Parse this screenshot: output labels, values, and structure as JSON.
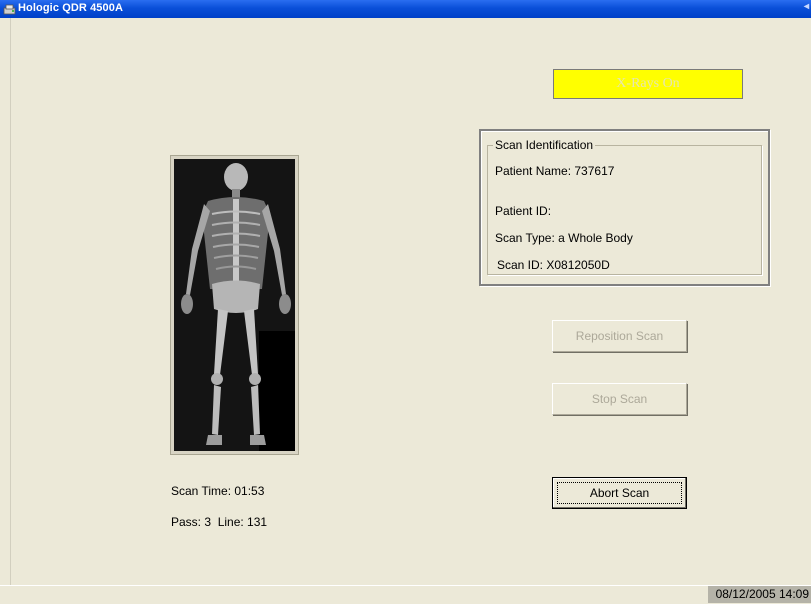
{
  "window": {
    "title": "Hologic QDR 4500A",
    "app_icon": "hologic-app-icon"
  },
  "status": {
    "xrays": "X-Rays On",
    "xrays_color": "#ffff00"
  },
  "scan_identification": {
    "legend": "Scan Identification",
    "patient_name": "Patient Name: 737617",
    "patient_id": "Patient ID:",
    "scan_type": "Scan Type: a Whole Body",
    "scan_id": "Scan ID: X0812050D"
  },
  "buttons": {
    "reposition": "Reposition Scan",
    "stop": "Stop Scan",
    "abort": "Abort Scan"
  },
  "scan_progress": {
    "scan_time": "Scan Time: 01:53",
    "pass_line": "Pass: 3  Line: 131"
  },
  "statusbar": {
    "datetime": "08/12/2005 14:09"
  }
}
